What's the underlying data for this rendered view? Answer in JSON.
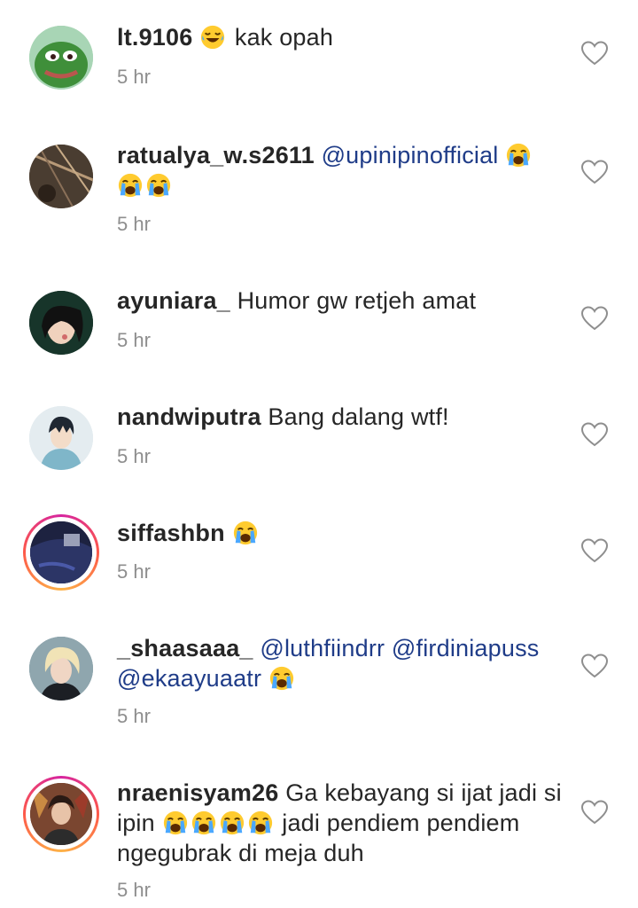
{
  "comments": [
    {
      "username": "lt.9106",
      "text_before": "",
      "emoji": "laugh",
      "text_after": "kak opah",
      "time": "5 hr"
    },
    {
      "username": "ratualya_w.s2611",
      "mention1": "@upinipinofficial",
      "time": "5 hr"
    },
    {
      "username": "ayuniara_",
      "text": "Humor gw retjeh amat",
      "time": "5 hr"
    },
    {
      "username": "nandwiputra",
      "text": "Bang dalang wtf!",
      "time": "5 hr"
    },
    {
      "username": "siffashbn",
      "time": "5 hr"
    },
    {
      "username": "_shaasaaa_",
      "mention1": "@luthfiindrr",
      "mention2": "@firdiniapuss",
      "mention3": "@ekaayuaatr",
      "time": "5 hr"
    },
    {
      "username": "nraenisyam26",
      "text1": "Ga kebayang si ijat jadi si",
      "text2a": "ipin",
      "text2b": "jadi pendiem pendiem",
      "text3": "ngegubrak di meja duh",
      "time": "5 hr"
    }
  ],
  "icons": {
    "like": "heart-outline-icon",
    "laugh_emoji": "face-with-tears-of-joy",
    "cry_emoji": "loudly-crying-face"
  },
  "colors": {
    "mention": "#1f3c88",
    "timestamp": "#8e8e8e",
    "story_ring": "#d6249f"
  }
}
